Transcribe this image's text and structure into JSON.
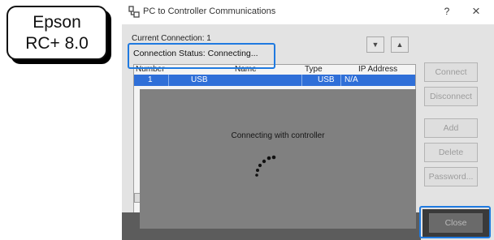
{
  "badge": {
    "line1": "Epson",
    "line2": "RC+ 8.0"
  },
  "window": {
    "title": "PC to Controller Communications",
    "help": "?",
    "close": "×",
    "current_connection": "Current Connection: 1",
    "status": "Connection Status: Connecting...",
    "arrow_down": "▼",
    "arrow_up": "▲"
  },
  "table": {
    "headers": {
      "number": "Number",
      "name": "Name",
      "type": "Type",
      "ip": "IP Address"
    },
    "rows": [
      {
        "number": "1",
        "name": "USB",
        "type": "USB",
        "ip": "N/A"
      }
    ]
  },
  "buttons": {
    "connect": "Connect",
    "disconnect": "Disconnect",
    "add": "Add",
    "delete": "Delete",
    "password": "Password...",
    "close": "Close"
  },
  "overlay": {
    "message": "Connecting with controller"
  },
  "colors": {
    "accent": "#1f7ae0",
    "selection": "#2f6fd8",
    "overlay": "#808080"
  }
}
